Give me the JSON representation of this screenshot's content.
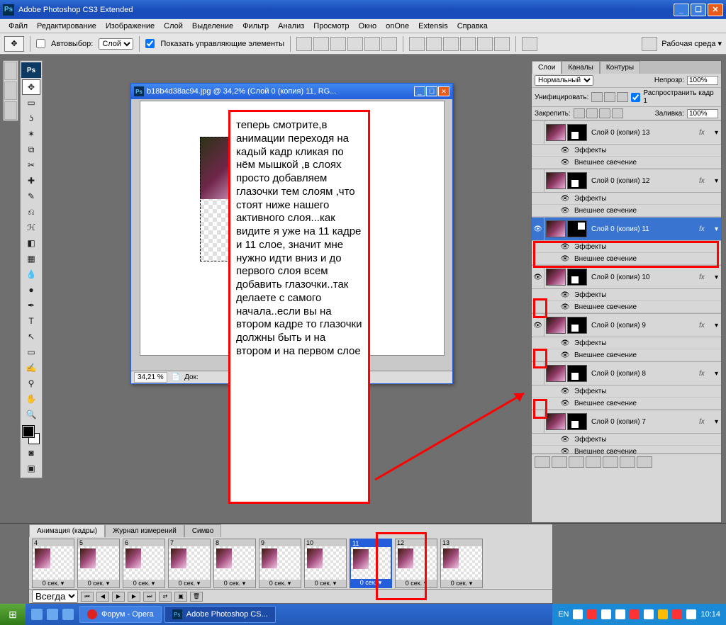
{
  "title": "Adobe Photoshop CS3 Extended",
  "menus": [
    "Файл",
    "Редактирование",
    "Изображение",
    "Слой",
    "Выделение",
    "Фильтр",
    "Анализ",
    "Просмотр",
    "Окно",
    "onOne",
    "Extensis",
    "Справка"
  ],
  "optionbar": {
    "autoselect_label": "Автовыбор:",
    "autoselect_value": "Слой",
    "show_controls": "Показать управляющие элементы",
    "workspace": "Рабочая среда ▾"
  },
  "doc": {
    "title": "b18b4d38ac94.jpg @ 34,2% (Слой 0 (копия) 11, RG...",
    "zoom": "34,21 %",
    "status": "Док:"
  },
  "tutorial_text": "теперь смотрите,в анимации переходя на кадый кадр кликая по нём мышкой ,в слоях просто добавляем глазочки тем слоям ,что стоят ниже нашего активного слоя...как видите я уже на 11 кадре и 11 слое, значит мне нужно идти вниз и до первого слоя всем добавить глазочки..так делаете с самого начала..если вы на втором кадре то глазочки должны быть и на втором и на первом слое",
  "layers_panel": {
    "tabs": [
      "Слои",
      "Каналы",
      "Контуры"
    ],
    "blendmode": "Нормальный",
    "opacity_label": "Непрозр:",
    "opacity": "100%",
    "unify_label": "Унифицировать:",
    "propagate": "Распространить кадр 1",
    "lock_label": "Закрепить:",
    "fill_label": "Заливка:",
    "fill": "100%",
    "fx_label": "Эффекты",
    "glow_label": "Внешнее свечение",
    "layers": [
      {
        "name": "Слой 0 (копия) 13",
        "vis": false,
        "sel": false,
        "redvis": false
      },
      {
        "name": "Слой 0 (копия) 12",
        "vis": false,
        "sel": false,
        "redvis": false
      },
      {
        "name": "Слой 0 (копия) 11",
        "vis": true,
        "sel": true,
        "redvis": false
      },
      {
        "name": "Слой 0 (копия) 10",
        "vis": true,
        "sel": false,
        "redvis": true
      },
      {
        "name": "Слой 0 (копия) 9",
        "vis": true,
        "sel": false,
        "redvis": true
      },
      {
        "name": "Слой 0 (копия) 8",
        "vis": false,
        "sel": false,
        "redvis": true
      },
      {
        "name": "Слой 0 (копия) 7",
        "vis": false,
        "sel": false,
        "redvis": false
      }
    ]
  },
  "animation": {
    "tabs": [
      "Анимация (кадры)",
      "Журнал измерений",
      "Симво"
    ],
    "frame_time": "0 сек.",
    "loop": "Всегда",
    "frames": [
      4,
      5,
      6,
      7,
      8,
      9,
      10,
      11,
      12,
      13
    ],
    "selected": 11
  },
  "taskbar": {
    "tasks": [
      {
        "label": "Форум - Opera",
        "ico": "O",
        "active": false
      },
      {
        "label": "Adobe Photoshop CS...",
        "ico": "Ps",
        "active": true
      }
    ],
    "lang": "EN",
    "clock": "10:14"
  }
}
